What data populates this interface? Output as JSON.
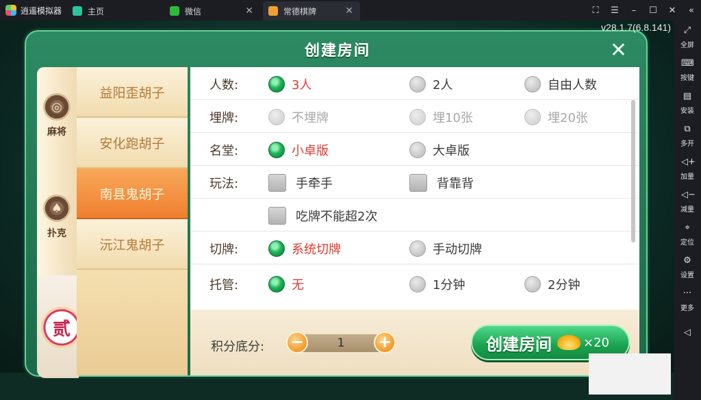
{
  "emulator": {
    "brand": "逍遥模拟器",
    "tabs": [
      {
        "label": "主页",
        "color": "#2ec29a"
      },
      {
        "label": "微信",
        "color": "#2bba3a"
      },
      {
        "label": "常德棋牌",
        "color": "#f0a030"
      }
    ],
    "sidebar": [
      {
        "icon": "fullscreen-icon",
        "label": "全屏"
      },
      {
        "icon": "keyboard-icon",
        "label": "按键"
      },
      {
        "icon": "apk-icon",
        "label": "安装"
      },
      {
        "icon": "multi-instance-icon",
        "label": "多开"
      },
      {
        "icon": "volume-up-icon",
        "label": "加量"
      },
      {
        "icon": "volume-down-icon",
        "label": "减量"
      },
      {
        "icon": "location-icon",
        "label": "定位"
      },
      {
        "icon": "settings-icon",
        "label": "设置"
      },
      {
        "icon": "more-icon",
        "label": "更多"
      }
    ]
  },
  "game": {
    "version": "v28.1.7(6.8.141)"
  },
  "dialog": {
    "title": "创建房间",
    "categories": [
      {
        "label": "麻将",
        "icon": "mahjong-icon"
      },
      {
        "label": "扑克",
        "icon": "spade-icon"
      }
    ],
    "badge": "贰",
    "game_list": [
      {
        "label": "益阳歪胡子",
        "active": false
      },
      {
        "label": "安化跑胡子",
        "active": false
      },
      {
        "label": "南县鬼胡子",
        "active": true
      },
      {
        "label": "沅江鬼胡子",
        "active": false
      }
    ],
    "options": {
      "players": {
        "label": "人数:",
        "choices": [
          "3人",
          "2人",
          "自由人数"
        ]
      },
      "bury": {
        "label": "埋牌:",
        "choices": [
          "不埋牌",
          "埋10张",
          "埋20张"
        ]
      },
      "hall": {
        "label": "名堂:",
        "choices": [
          "小卓版",
          "大卓版"
        ]
      },
      "rules": {
        "label": "玩法:",
        "choices": [
          "手牵手",
          "背靠背",
          "吃牌不能超2次"
        ]
      },
      "cut": {
        "label": "切牌:",
        "choices": [
          "系统切牌",
          "手动切牌"
        ]
      },
      "auto": {
        "label": "托管:",
        "choices": [
          "无",
          "1分钟",
          "2分钟"
        ]
      }
    },
    "score": {
      "label": "积分底分:",
      "value": "1",
      "minus": "−",
      "plus": "+"
    },
    "create": {
      "label": "创建房间",
      "cost": "×20"
    },
    "colors": {
      "selected_text": "#e03a30",
      "accent_green": "#1aa24e"
    }
  }
}
